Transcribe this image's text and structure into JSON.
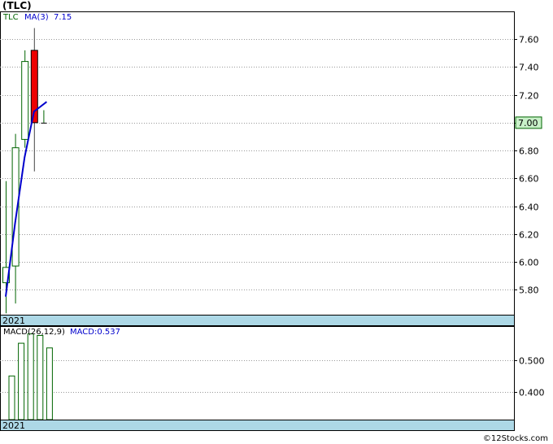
{
  "title": "(TLC)",
  "watermark": "©12Stocks.com",
  "colors": {
    "grid": "#999999",
    "up": "#006400",
    "down_fill": "#ee0000",
    "ma_line": "#0000cc",
    "date_bar": "#add8e6",
    "price_badge": "#c8f0c8",
    "macd_bar": "#006400",
    "label_ticker": "#006400",
    "label_ma": "#0000cc"
  },
  "chart_data": [
    {
      "type": "candlestick",
      "ticker_label": "TLC",
      "indicator_label": "MA(3)",
      "indicator_value": "7.15",
      "last_price_label": "7.00",
      "last_price": 7.0,
      "x_label": "2021",
      "ylim": [
        5.62,
        7.8
      ],
      "yticks": [
        5.8,
        6.0,
        6.2,
        6.4,
        6.6,
        6.8,
        7.0,
        7.2,
        7.4,
        7.6
      ],
      "ytick_labels": [
        "5.80",
        "6.00",
        "6.20",
        "6.40",
        "6.60",
        "6.80",
        "7.00",
        "7.20",
        "7.40",
        "7.60"
      ],
      "grid": true,
      "candles": [
        {
          "open": 5.85,
          "high": 6.58,
          "low": 5.63,
          "close": 5.96
        },
        {
          "open": 5.97,
          "high": 6.92,
          "low": 5.7,
          "close": 6.82
        },
        {
          "open": 6.88,
          "high": 7.52,
          "low": 6.82,
          "close": 7.44
        },
        {
          "open": 7.52,
          "high": 7.68,
          "low": 6.65,
          "close": 7.0
        },
        {
          "open": 7.0,
          "high": 7.09,
          "low": 7.0,
          "close": 7.0
        }
      ],
      "ma": [
        5.75,
        6.28,
        6.75,
        7.08,
        7.15
      ]
    },
    {
      "type": "bar",
      "indicator_label": "MACD(26,12,9)",
      "indicator_value_label": "MACD:0.537",
      "x_label": "2021",
      "ylim": [
        0.31,
        0.61
      ],
      "yticks": [
        0.4,
        0.5
      ],
      "ytick_labels": [
        "0.400",
        "0.500"
      ],
      "grid": true,
      "values": [
        0.45,
        0.555,
        0.585,
        0.58,
        0.54
      ]
    }
  ]
}
